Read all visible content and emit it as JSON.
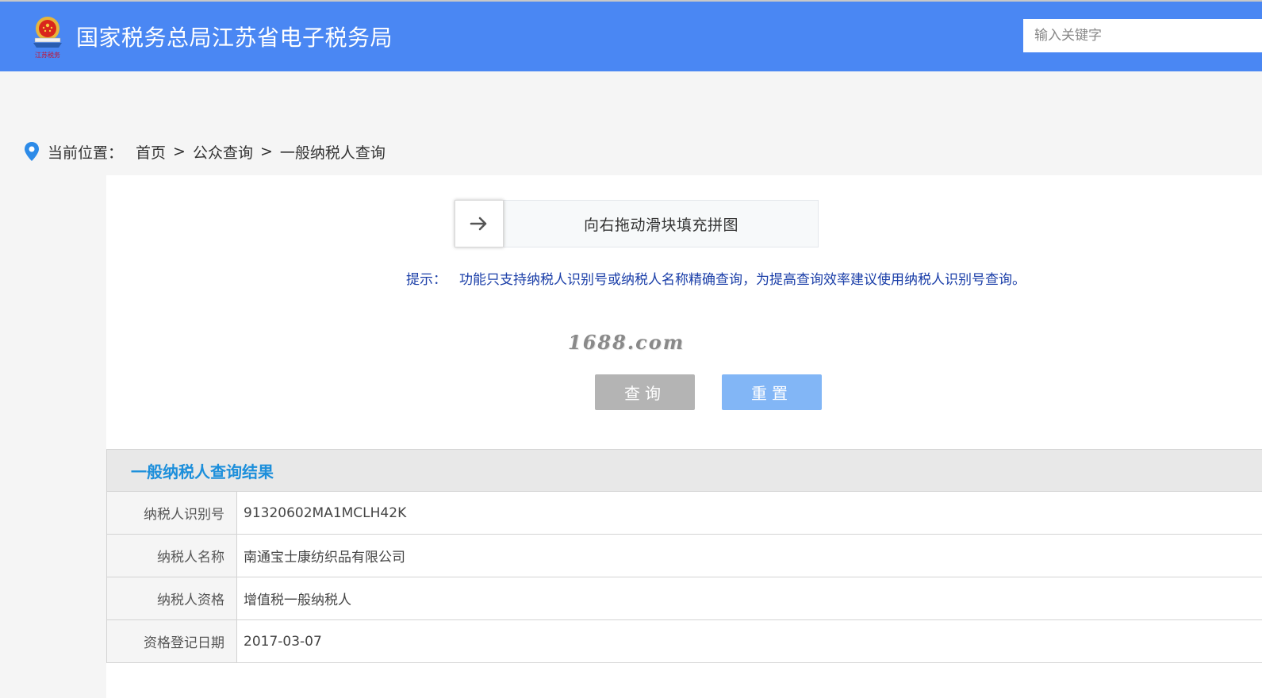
{
  "header": {
    "logo_text": "江苏税务",
    "title": "国家税务总局江苏省电子税务局",
    "search_placeholder": "输入关键字"
  },
  "breadcrumb": {
    "label": "当前位置：",
    "items": [
      "首页",
      "公众查询",
      "一般纳税人查询"
    ],
    "separator": ">"
  },
  "captcha": {
    "slider_text": "向右拖动滑块填充拼图"
  },
  "tip": {
    "label": "提示：",
    "text": "功能只支持纳税人识别号或纳税人名称精确查询，为提高查询效率建议使用纳税人识别号查询。"
  },
  "watermark": "1688.com",
  "buttons": {
    "query": "查询",
    "reset": "重置"
  },
  "results": {
    "title": "一般纳税人查询结果",
    "rows": [
      {
        "label": "纳税人识别号",
        "value": "91320602MA1MCLH42K"
      },
      {
        "label": "纳税人名称",
        "value": "南通宝士康纺织品有限公司"
      },
      {
        "label": "纳税人资格",
        "value": "增值税一般纳税人"
      },
      {
        "label": "资格登记日期",
        "value": "2017-03-07"
      }
    ]
  },
  "colors": {
    "header_bg": "#4a87f3",
    "tip_text": "#1a3ea8",
    "results_title": "#1d8fdb",
    "query_button": "#b4b4b4",
    "reset_button": "#82b6f6"
  }
}
